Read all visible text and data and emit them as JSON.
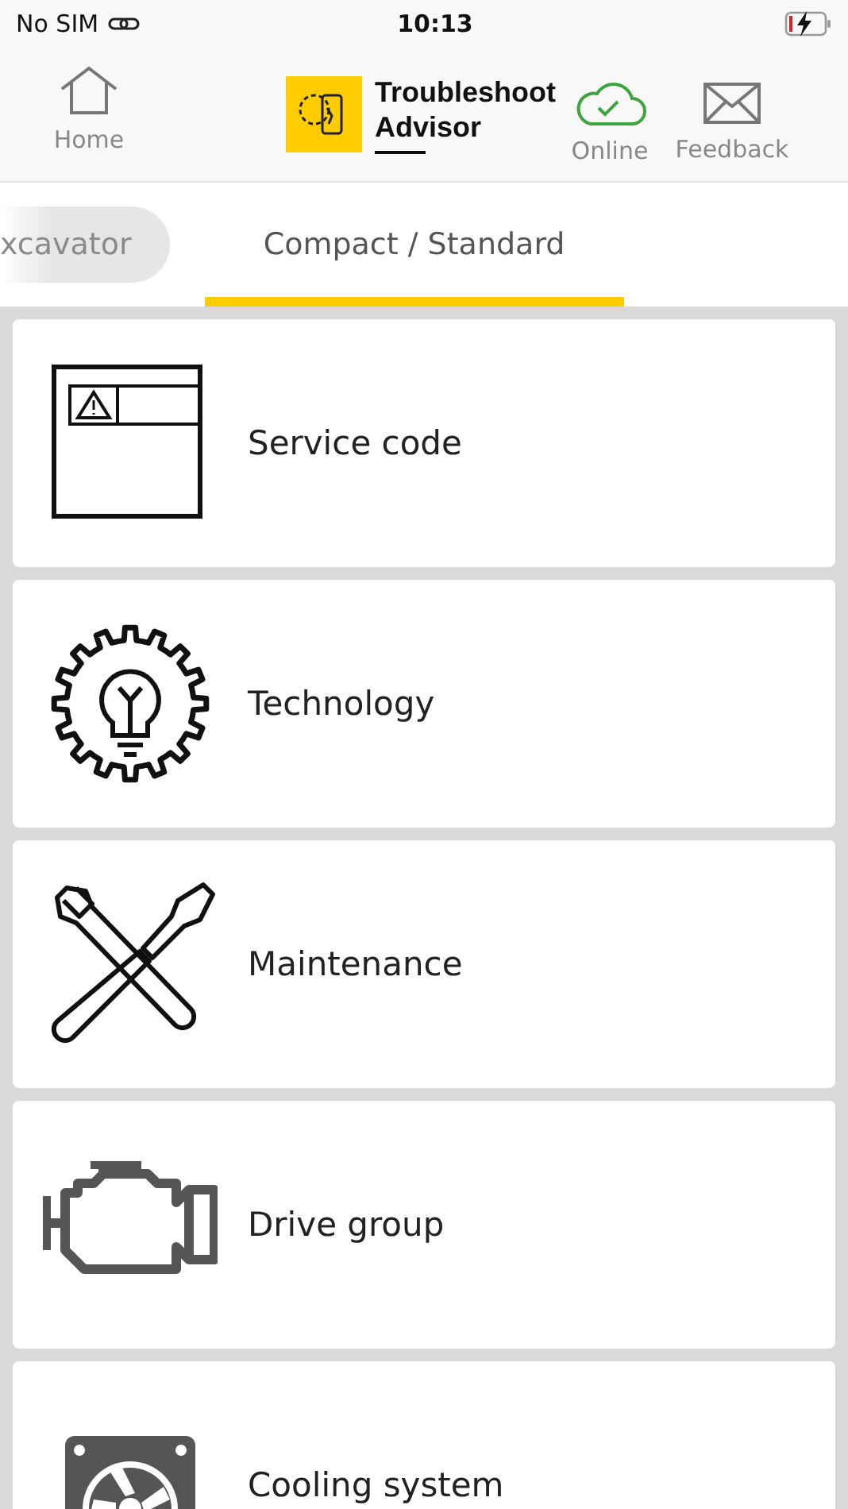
{
  "status_bar": {
    "carrier": "No SIM",
    "time": "10:13",
    "charging": true
  },
  "header": {
    "home_label": "Home",
    "app_title": "Troubleshoot Advisor",
    "connection": {
      "label": "Online",
      "online": true
    },
    "feedback_label": "Feedback"
  },
  "tabs": [
    {
      "label": "xcavator",
      "selected": false
    },
    {
      "label": "Compact / Standard",
      "selected": true
    }
  ],
  "categories": [
    {
      "kind": "service-code",
      "label": "Service code"
    },
    {
      "kind": "technology",
      "label": "Technology"
    },
    {
      "kind": "maintenance",
      "label": "Maintenance"
    },
    {
      "kind": "drive",
      "label": "Drive group"
    },
    {
      "kind": "cooling",
      "label": "Cooling system"
    }
  ]
}
